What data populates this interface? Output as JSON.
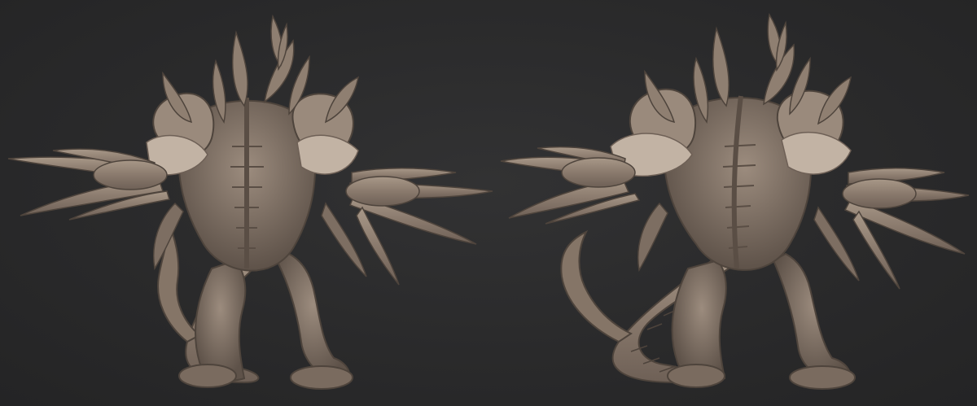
{
  "scene": {
    "background_color": "#2a2a2b",
    "clay_color": "#8a7a6d",
    "clay_highlight": "#b8a99b",
    "clay_shadow": "#4e443c",
    "views": [
      {
        "label": "",
        "kind": "back-view"
      },
      {
        "label": "",
        "kind": "three-quarter-back-view"
      }
    ]
  }
}
